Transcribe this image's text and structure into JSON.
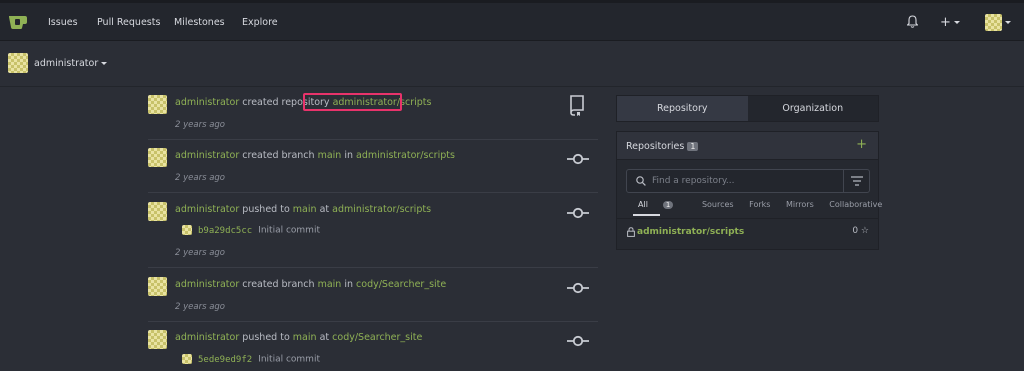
{
  "nav": {
    "items": [
      "Issues",
      "Pull Requests",
      "Milestones",
      "Explore"
    ],
    "plus_label": "+"
  },
  "context": {
    "user": "administrator"
  },
  "feed": [
    {
      "actor": "administrator",
      "verb": "created repository",
      "target": "administrator/scripts",
      "time": "2 years ago",
      "icon": "repo-icon"
    },
    {
      "actor": "administrator",
      "verb": "created branch",
      "branch": "main",
      "prep": "in",
      "target": "administrator/scripts",
      "time": "2 years ago",
      "icon": "commit-icon"
    },
    {
      "actor": "administrator",
      "verb": "pushed to",
      "branch": "main",
      "prep": "at",
      "target": "administrator/scripts",
      "commit_sha": "b9a29dc5cc",
      "commit_msg": "Initial commit",
      "time": "2 years ago",
      "icon": "commit-icon"
    },
    {
      "actor": "administrator",
      "verb": "created branch",
      "branch": "main",
      "prep": "in",
      "target": "cody/Searcher_site",
      "time": "2 years ago",
      "icon": "commit-icon"
    },
    {
      "actor": "administrator",
      "verb": "pushed to",
      "branch": "main",
      "prep": "at",
      "target": "cody/Searcher_site",
      "commit_sha": "5ede9ed9f2",
      "commit_msg": "Initial commit",
      "icon": "commit-icon"
    }
  ],
  "panel": {
    "tabs": [
      "Repository",
      "Organization"
    ],
    "repos_title": "Repositories",
    "repos_count": "1",
    "search_placeholder": "Find a repository...",
    "filters": [
      "All",
      "Sources",
      "Forks",
      "Mirrors",
      "Collaborative"
    ],
    "all_count": "1",
    "repos": [
      {
        "name": "administrator/scripts",
        "stars": "0"
      }
    ]
  },
  "colors": {
    "link": "#8fb155",
    "highlight": "#e8336b",
    "background": "#2b2e36"
  }
}
